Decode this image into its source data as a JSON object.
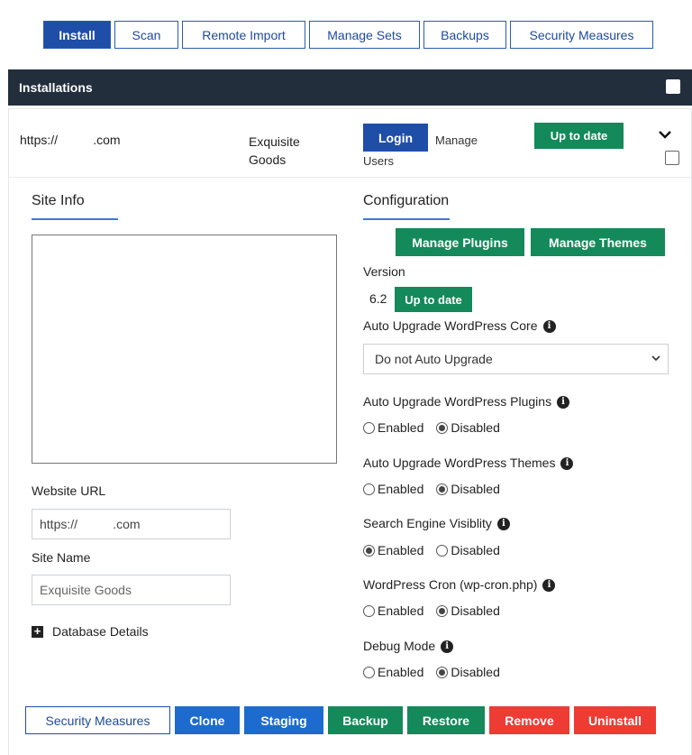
{
  "tabs": [
    "Install",
    "Scan",
    "Remote Import",
    "Manage Sets",
    "Backups",
    "Security Measures"
  ],
  "header": {
    "title": "Installations"
  },
  "install_row": {
    "url": "https://              .com",
    "site_name_line1": "Exquisite",
    "site_name_line2": "Goods",
    "login_label": "Login",
    "manage_users_label": "Manage Users",
    "status_label": "Up to date"
  },
  "site_info": {
    "title": "Site Info",
    "website_url_label": "Website URL",
    "website_url_value": "https://              .com",
    "site_name_label": "Site Name",
    "site_name_placeholder": "Exquisite Goods",
    "database_details_label": "Database Details"
  },
  "configuration": {
    "title": "Configuration",
    "manage_plugins_label": "Manage Plugins",
    "manage_themes_label": "Manage Themes",
    "version_label": "Version",
    "version_value": "6.2",
    "version_status": "Up to date",
    "auto_core_label": "Auto Upgrade WordPress Core",
    "auto_core_value": "Do not Auto Upgrade",
    "auto_plugins_label": "Auto Upgrade WordPress Plugins",
    "auto_themes_label": "Auto Upgrade WordPress Themes",
    "search_label": "Search Engine Visiblity",
    "cron_label": "WordPress Cron (wp-cron.php)",
    "debug_label": "Debug Mode",
    "enabled_label": "Enabled",
    "disabled_label": "Disabled"
  },
  "actions": [
    "Security Measures",
    "Clone",
    "Staging",
    "Backup",
    "Restore",
    "Remove",
    "Uninstall"
  ],
  "colors": {
    "primary": "#1e4ea8",
    "success": "#14895a",
    "danger": "#ee3b33",
    "header_bg": "#222e3c"
  }
}
